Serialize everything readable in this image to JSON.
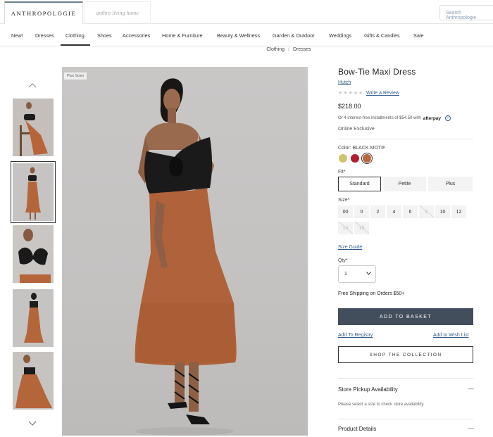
{
  "header": {
    "brand": "ANTHROPOLOGIE",
    "brand2": "anthro living home",
    "search_placeholder": "Search Anthropologie"
  },
  "nav": {
    "items": [
      "New!",
      "Dresses",
      "Clothing",
      "Shoes",
      "Accessories",
      "Home & Furniture",
      "Beauty & Wellness",
      "Garden & Outdoor",
      "Weddings",
      "Gifts & Candles",
      "Sale"
    ],
    "active": "Clothing"
  },
  "breadcrumb": [
    "Clothing",
    "Dresses"
  ],
  "gallery": {
    "badge": "Plus Sizes",
    "selected_thumb": 2,
    "thumb_count": 5
  },
  "product": {
    "title": "Bow-Tie Maxi Dress",
    "brand": "Hutch",
    "stars": "★★★★★",
    "review_link": "Write a Review",
    "price": "$218.00",
    "installments": "Or 4 interest-free installments of $54.50 with",
    "afterpay": "afterpay",
    "exclusive": "Online Exclusive",
    "color_label": "Color: BLACK MOTIF",
    "swatches": [
      {
        "name": "yellow-swatch",
        "color": "#cfc26a"
      },
      {
        "name": "red-swatch",
        "color": "#b51c30"
      },
      {
        "name": "rust-swatch",
        "color": "#b5683c"
      }
    ],
    "selected_swatch": 2,
    "fit_label": "Fit*",
    "fits": [
      "Standard",
      "Petite",
      "Plus"
    ],
    "selected_fit": "Standard",
    "size_label": "Size*",
    "sizes": [
      "00",
      "0",
      "2",
      "4",
      "6",
      "8",
      "10",
      "12",
      "14",
      "16"
    ],
    "unavailable_sizes": [
      "8",
      "14",
      "16"
    ],
    "size_guide": "Size Guide",
    "qty_label": "Qty*",
    "qty_value": "1",
    "shipping": "Free Shipping on Orders $50+",
    "add_to_basket": "ADD TO BASKET",
    "add_registry": "Add To Registry",
    "add_wishlist": "Add to Wish List",
    "shop_collection": "SHOP THE COLLECTION",
    "pickup_title": "Store Pickup Availability",
    "pickup_msg": "Please select a size to check store availability.",
    "details_title": "Product Details"
  },
  "colors": {
    "link": "#2f5d8a",
    "button": "#434e5d"
  }
}
